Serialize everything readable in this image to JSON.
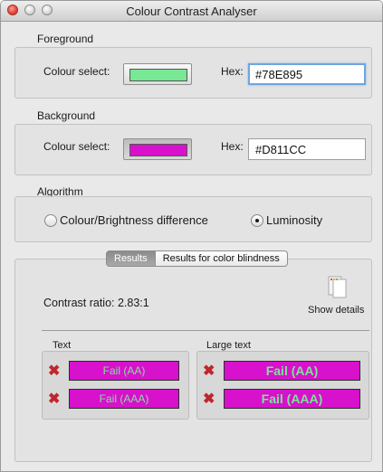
{
  "window": {
    "title": "Colour Contrast Analyser"
  },
  "foreground": {
    "section_label": "Foreground",
    "colour_select_label": "Colour select:",
    "swatch_color": "#78E895",
    "hex_label": "Hex:",
    "hex_value": "#78E895"
  },
  "background": {
    "section_label": "Background",
    "colour_select_label": "Colour select:",
    "swatch_color": "#D811CC",
    "hex_label": "Hex:",
    "hex_value": "#D811CC"
  },
  "algorithm": {
    "section_label": "Algorithm",
    "options": [
      {
        "label": "Colour/Brightness difference",
        "checked": false
      },
      {
        "label": "Luminosity",
        "checked": true
      }
    ]
  },
  "results": {
    "tabs": [
      {
        "label": "Results",
        "active": true
      },
      {
        "label": "Results for color blindness",
        "active": false
      }
    ],
    "contrast_ratio": "Contrast ratio: 2.83:1",
    "show_details_label": "Show details",
    "text": {
      "label": "Text",
      "aa": "Fail (AA)",
      "aaa": "Fail (AAA)"
    },
    "large_text": {
      "label": "Large text",
      "aa": "Fail (AA)",
      "aaa": "Fail (AAA)"
    },
    "fail_box_bg": "#D811CC",
    "fail_box_text": "#78E895",
    "fail_icon_color": "#C0262C"
  }
}
